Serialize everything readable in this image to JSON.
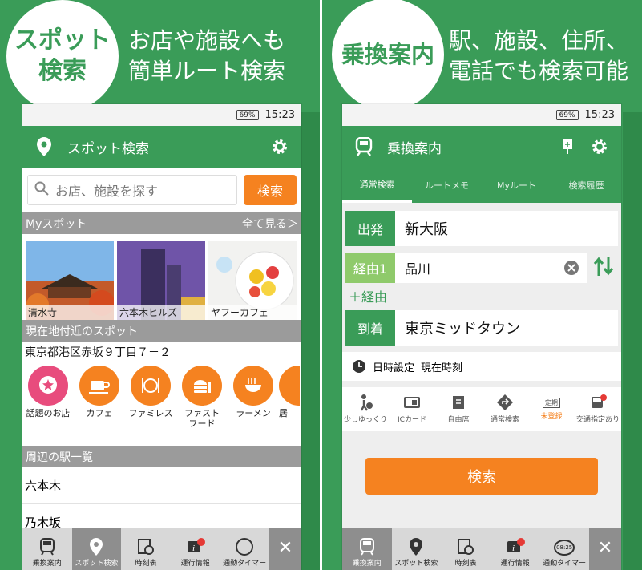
{
  "left": {
    "circle": [
      "スポット",
      "検索"
    ],
    "tagline": [
      "お店や施設へも",
      "簡単ルート検索"
    ],
    "status": {
      "battery": "69%",
      "time": "15:23"
    },
    "appbar": {
      "title": "スポット検索"
    },
    "search": {
      "placeholder": "お店、施設を探す",
      "button": "検索"
    },
    "myspot": {
      "label": "Myスポット",
      "more": "全て見る＞"
    },
    "photos": [
      "清水寺",
      "六本木ヒルズ",
      "ヤフーカフェ"
    ],
    "nearby": {
      "label": "現在地付近のスポット",
      "address": "東京都港区赤坂９丁目７－２"
    },
    "categories": [
      {
        "label": "話題のお店",
        "icon": "star-chat-icon"
      },
      {
        "label": "カフェ",
        "icon": "coffee-cup-icon"
      },
      {
        "label": "ファミレス",
        "icon": "fork-knife-icon"
      },
      {
        "label": "ファスト\nフード",
        "icon": "burger-drink-icon"
      },
      {
        "label": "ラーメン",
        "icon": "ramen-bowl-icon"
      },
      {
        "label": "居",
        "icon": "izakaya-icon"
      }
    ],
    "stations_label": "周辺の駅一覧",
    "stations": [
      "六本木",
      "乃木坂"
    ],
    "tabbar": [
      "乗換案内",
      "スポット検索",
      "時刻表",
      "運行情報",
      "通勤タイマー"
    ]
  },
  "right": {
    "circle": [
      "乗換案内"
    ],
    "tagline": [
      "駅、施設、住所、",
      "電話でも検索可能"
    ],
    "status": {
      "battery": "69%",
      "time": "15:23"
    },
    "appbar": {
      "title": "乗換案内"
    },
    "tabs": [
      "通常検索",
      "ルートメモ",
      "Myルート",
      "検索履歴"
    ],
    "from": {
      "label": "出発",
      "value": "新大阪"
    },
    "via": {
      "label": "経由1",
      "value": "品川",
      "add": "＋経由"
    },
    "to": {
      "label": "到着",
      "value": "東京ミッドタウン"
    },
    "time": {
      "label": "日時設定",
      "value": "現在時刻"
    },
    "options": [
      {
        "label": "少しゆっくり",
        "icon": "walker-icon"
      },
      {
        "label": "ICカード",
        "icon": "ic-card-icon"
      },
      {
        "label": "自由席",
        "icon": "seat-icon"
      },
      {
        "label": "通常検索",
        "icon": "route-sign-icon"
      },
      {
        "label": "未登録",
        "top": "定期",
        "icon": "commuter-pass-icon"
      },
      {
        "label": "交通指定あり",
        "icon": "bus-icon"
      }
    ],
    "search_button": "検索",
    "tabbar": [
      "乗換案内",
      "スポット検索",
      "時刻表",
      "運行情報",
      "通勤タイマー"
    ],
    "timer_badge": "08:25"
  },
  "colors": {
    "brand_green": "#3a9c58",
    "accent_orange": "#f58220",
    "via_green": "#8fca6b",
    "alert_red": "#e53935"
  }
}
